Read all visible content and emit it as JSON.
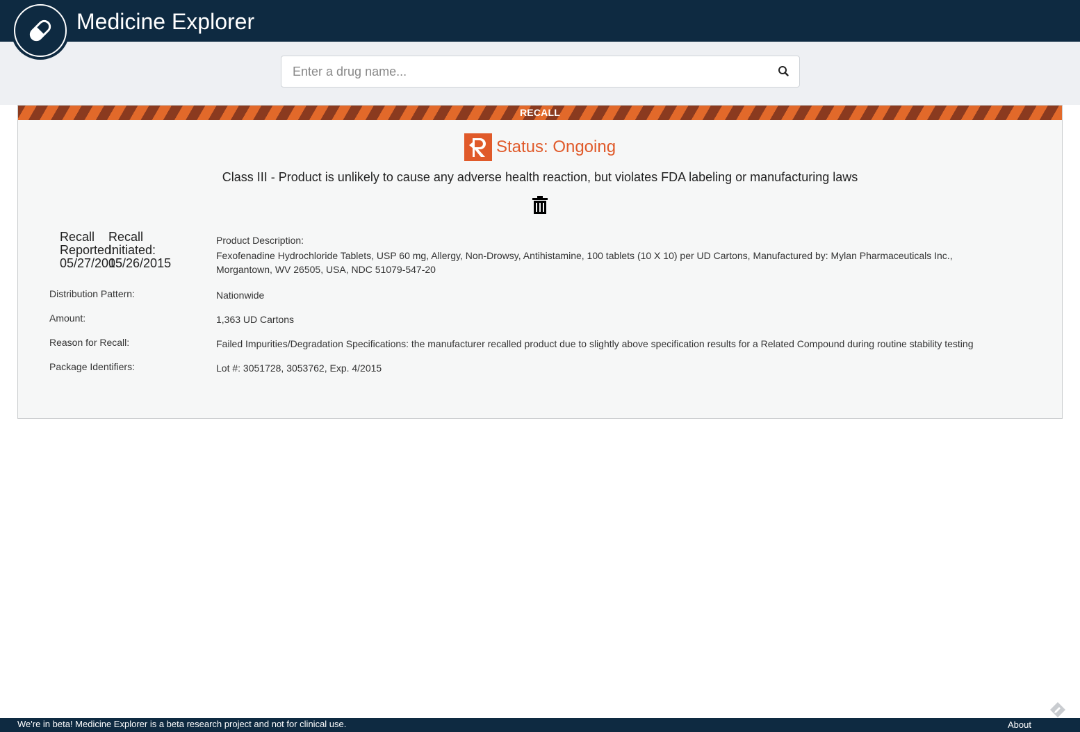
{
  "app": {
    "title": "Medicine Explorer",
    "logo_icon": "pill-icon"
  },
  "search": {
    "placeholder": "Enter a drug name...",
    "value": "",
    "button_icon": "search-icon"
  },
  "recall": {
    "banner": "RECALL",
    "badge_icon": "recall-r-icon",
    "status": "Status: Ongoing",
    "classification": "Class III - Product is unlikely to cause any adverse health reaction, but violates FDA labeling or manufacturing laws",
    "delete_icon": "trash-icon",
    "reported": {
      "line1": "Recall",
      "line2": "Reported:",
      "date": "05/27/2015"
    },
    "initiated": {
      "line1": "Recall",
      "line2": "Initiated:",
      "date": "05/26/2015"
    },
    "product_description": {
      "label": "Product Description:",
      "value": "Fexofenadine Hydrochloride Tablets, USP 60 mg, Allergy, Non-Drowsy, Antihistamine, 100 tablets (10 X 10) per UD Cartons, Manufactured by: Mylan Pharmaceuticals Inc., Morgantown, WV 26505, USA, NDC 51079-547-20"
    },
    "distribution_pattern": {
      "label": "Distribution Pattern:",
      "value": "Nationwide"
    },
    "amount": {
      "label": "Amount:",
      "value": "1,363 UD Cartons"
    },
    "reason": {
      "label": "Reason for Recall:",
      "value": "Failed Impurities/Degradation Specifications: the manufacturer recalled product due to slightly above specification results for a Related Compound during routine stability testing"
    },
    "package_identifiers": {
      "label": "Package Identifiers:",
      "value": "Lot #: 3051728, 3053762, Exp. 4/2015"
    }
  },
  "colors": {
    "header": "#0e2a41",
    "accent": "#e05a2a",
    "hazard_dark": "#8a3a1f",
    "panel": "#f6f7f7"
  },
  "footer": {
    "beta_note": "We're in beta! Medicine Explorer is a beta research project and not for clinical use.",
    "about_link": "About",
    "feedback_icon": "feedback-icon"
  }
}
